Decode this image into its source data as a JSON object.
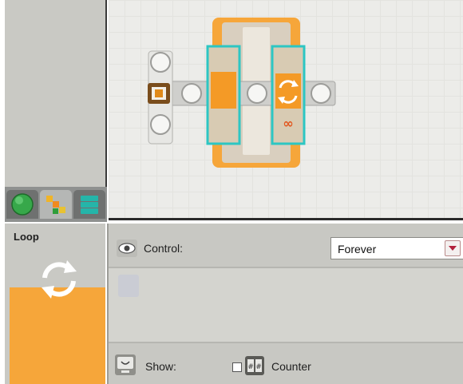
{
  "palette": {
    "tabs": [
      {
        "name": "common-palette",
        "icon": "green-circle-icon",
        "active": false
      },
      {
        "name": "complete-palette",
        "icon": "blocks-icon",
        "active": true
      },
      {
        "name": "custom-palette",
        "icon": "stack-icon",
        "active": false
      }
    ]
  },
  "colors": {
    "accent_orange": "#f6a63a",
    "selection_teal": "#2cc6c3",
    "panel_gray": "#c8c8c3"
  },
  "block": {
    "title": "Loop",
    "icon": "loop-arrows-icon"
  },
  "config": {
    "control_label": "Control:",
    "control_value": "Forever",
    "show_label": "Show:",
    "counter_label": "Counter",
    "counter_checked": false
  }
}
